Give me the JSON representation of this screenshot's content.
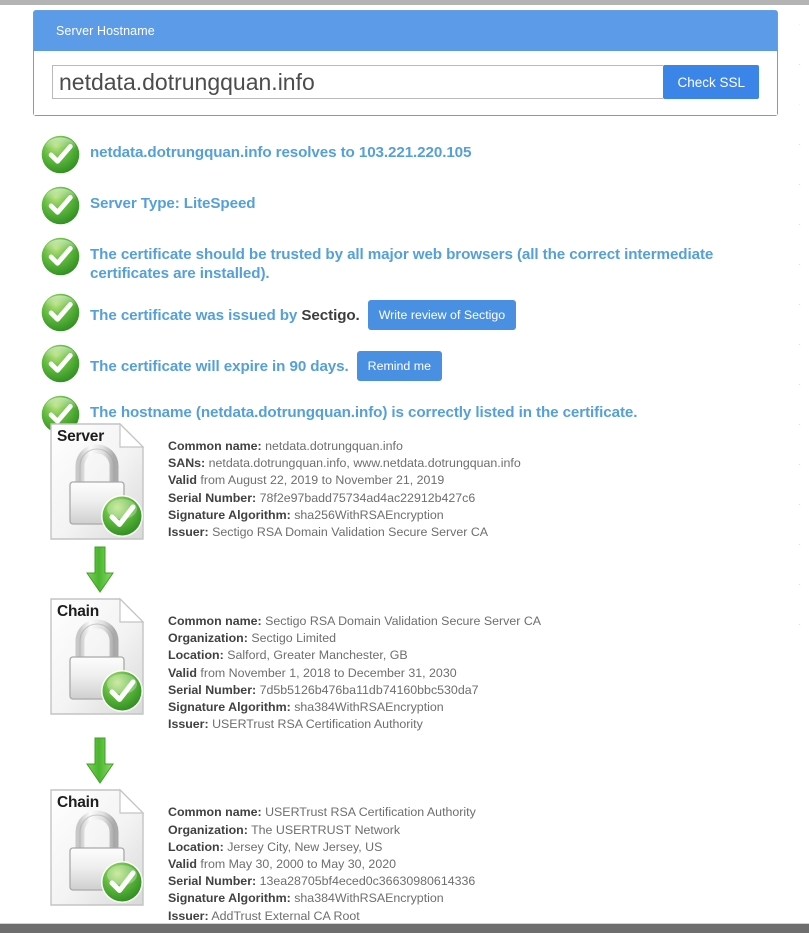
{
  "colors": {
    "header_blue": "#5b9be8",
    "button_blue": "#3b84e8",
    "inline_button_blue": "#4a90e2",
    "status_text_blue": "#55a0d8",
    "check_green": "#58b548",
    "label_gray": "#414141",
    "value_gray": "#6e6e6e"
  },
  "panel": {
    "title": "Server Hostname",
    "input": {
      "value": "netdata.dotrungquan.info",
      "placeholder": "Enter hostname"
    },
    "submit_label": "Check SSL"
  },
  "status": {
    "items": [
      {
        "icon": "green-check-icon",
        "text": "netdata.dotrungquan.info resolves to 103.221.220.105",
        "button": null
      },
      {
        "icon": "green-check-icon",
        "text": "Server Type: LiteSpeed",
        "button": null
      },
      {
        "icon": "green-check-icon",
        "text": "The certificate should be trusted by all major web browsers (all the correct intermediate certificates are installed).",
        "button": null
      },
      {
        "icon": "green-check-icon",
        "text_before": "The certificate was issued by ",
        "text_bold": "Sectigo.",
        "button": "Write review of Sectigo"
      },
      {
        "icon": "green-check-icon",
        "text": "The certificate will expire in 90 days.",
        "button": "Remind me"
      },
      {
        "icon": "green-check-icon",
        "text": "The hostname (netdata.dotrungquan.info) is correctly listed in the certificate.",
        "button": null
      }
    ]
  },
  "chain": {
    "certificates": [
      {
        "badge": "Server",
        "icon": "lock-document-valid-icon",
        "rows": [
          {
            "label": "Common name:",
            "value": "netdata.dotrungquan.info"
          },
          {
            "label": "SANs:",
            "value": "netdata.dotrungquan.info, www.netdata.dotrungquan.info"
          },
          {
            "label": "Valid",
            "value": "from August 22, 2019 to November 21, 2019"
          },
          {
            "label": "Serial Number:",
            "value": "78f2e97badd75734ad4ac22912b427c6"
          },
          {
            "label": "Signature Algorithm:",
            "value": "sha256WithRSAEncryption"
          },
          {
            "label": "Issuer:",
            "value": "Sectigo RSA Domain Validation Secure Server CA"
          }
        ]
      },
      {
        "badge": "Chain",
        "icon": "lock-document-valid-icon",
        "rows": [
          {
            "label": "Common name:",
            "value": "Sectigo RSA Domain Validation Secure Server CA"
          },
          {
            "label": "Organization:",
            "value": "Sectigo Limited"
          },
          {
            "label": "Location:",
            "value": "Salford, Greater Manchester, GB"
          },
          {
            "label": "Valid",
            "value": "from November 1, 2018 to December 31, 2030"
          },
          {
            "label": "Serial Number:",
            "value": "7d5b5126b476ba11db74160bbc530da7"
          },
          {
            "label": "Signature Algorithm:",
            "value": "sha384WithRSAEncryption"
          },
          {
            "label": "Issuer:",
            "value": "USERTrust RSA Certification Authority"
          }
        ]
      },
      {
        "badge": "Chain",
        "icon": "lock-document-valid-icon",
        "rows": [
          {
            "label": "Common name:",
            "value": "USERTrust RSA Certification Authority"
          },
          {
            "label": "Organization:",
            "value": "The USERTRUST Network"
          },
          {
            "label": "Location:",
            "value": "Jersey City, New Jersey, US"
          },
          {
            "label": "Valid",
            "value": "from May 30, 2000 to May 30, 2020"
          },
          {
            "label": "Serial Number:",
            "value": "13ea28705bf4eced0c36630980614336"
          },
          {
            "label": "Signature Algorithm:",
            "value": "sha384WithRSAEncryption"
          },
          {
            "label": "Issuer:",
            "value": "AddTrust External CA Root"
          }
        ]
      }
    ],
    "connector_icon": "green-down-arrow-icon"
  }
}
